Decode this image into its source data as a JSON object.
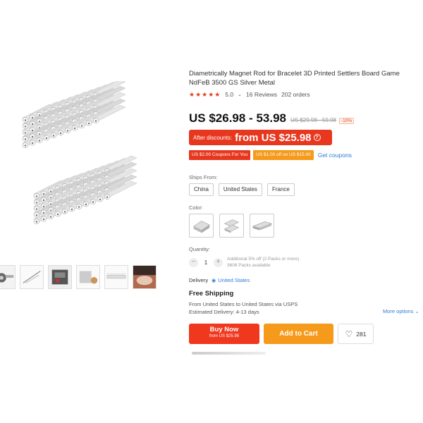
{
  "product": {
    "title": "Diametrically Magnet Rod for Bracelet 3D Printed Settlers Board Game NdFeB 3500 GS Silver Metal",
    "rating": "5.0",
    "reviews": "16 Reviews",
    "orders": "202 orders"
  },
  "pricing": {
    "price_range": "US $26.98 - 53.98",
    "old_price": "US $29.98 - 59.98",
    "discount": "-10%",
    "after_discount_label": "After discounts:",
    "after_discount_value": "from US $25.98"
  },
  "coupons": {
    "coupon_1": "US $2.00 Coupons For You",
    "coupon_2": "US $1.00 off on US $15.00",
    "get_coupons": "Get coupons"
  },
  "ships_from": {
    "label": "Ships From:",
    "options": [
      "China",
      "United States",
      "France"
    ]
  },
  "color": {
    "label": "Color:"
  },
  "quantity": {
    "label": "Quantity:",
    "value": "1",
    "note_1": "Additional 5% off (2 Packs or more)",
    "note_2": "3606 Packs available"
  },
  "delivery": {
    "label": "Delivery",
    "location": "United States"
  },
  "shipping": {
    "title": "Free Shipping",
    "route": "From United States to United States via USPS",
    "estimate": "Estimated Delivery: 4-13 days",
    "more_options": "More options"
  },
  "actions": {
    "buy_now": "Buy Now",
    "buy_now_sub": "from US $25.98",
    "add_to_cart": "Add to Cart",
    "wishlist_count": "281"
  },
  "colors": {
    "accent_red": "#e8371f",
    "accent_orange": "#f59a1b",
    "link_blue": "#2e7bd6"
  }
}
